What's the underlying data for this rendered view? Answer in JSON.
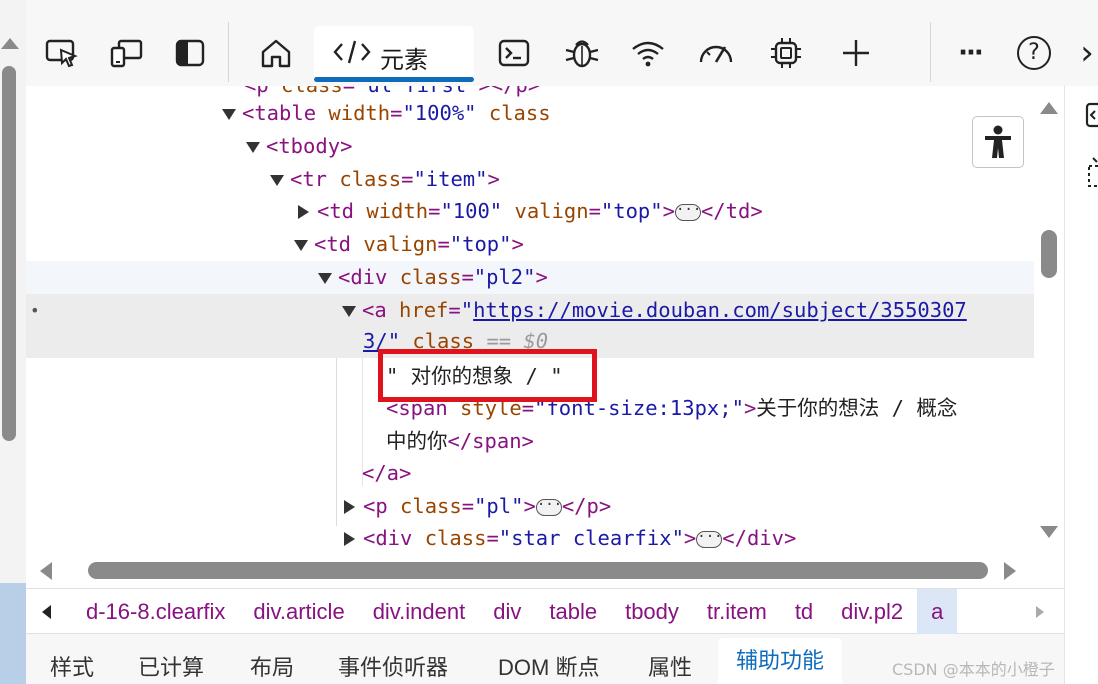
{
  "toolbar": {
    "tools": [
      {
        "name": "inspect-icon"
      },
      {
        "name": "device-emulation-icon"
      },
      {
        "name": "sidebar-toggle-icon"
      },
      {
        "name": "welcome-home-icon"
      },
      {
        "name": "console-icon"
      },
      {
        "name": "sources-bug-icon"
      },
      {
        "name": "network-wifi-icon"
      },
      {
        "name": "performance-gauge-icon"
      },
      {
        "name": "memory-chip-icon"
      },
      {
        "name": "more-tools-plus-icon"
      }
    ],
    "active_tab_label": "元素",
    "more_label": "···",
    "help_label": "?",
    "overflow_label": "›"
  },
  "dom_tree": {
    "lines": [
      {
        "pre": "<",
        "tag": "p",
        "attr": " class",
        "eq": "=",
        "val": "\"ul first\"",
        "rest": "></p>"
      },
      {
        "tag_open": "<table",
        "attr1": " width",
        "val1": "\"100%\"",
        "attr2": " class",
        "close": ">"
      },
      {
        "tag_open": "<tbody",
        "close": ">"
      },
      {
        "tag_open": "<tr",
        "attr1": " class",
        "val1": "\"item\"",
        "close": ">"
      },
      {
        "tag_open": "<td",
        "attr1": " width",
        "val1": "\"100\"",
        "attr2": " valign",
        "val2": "\"top\"",
        "close": ">",
        "end": "</td>"
      },
      {
        "tag_open": "<td",
        "attr1": " valign",
        "val1": "\"top\"",
        "close": ">"
      },
      {
        "tag_open": "<div",
        "attr1": " class",
        "val1": "\"pl2\"",
        "close": ">"
      },
      {
        "tag_open": "<a",
        "attr1": " href",
        "link1": "https://movie.douban.com/subject/3550307",
        "link2": "3/",
        "attr2": " class",
        "ghost": "== $0"
      },
      {
        "text": "\" 对你的想象 / \""
      },
      {
        "tag_open": "<span",
        "attr1": " style",
        "val1": "\"font-size:13px;\"",
        "close": ">",
        "text1": "关于你的想法 / 概念",
        "text2": "中的你",
        "end": "</span>"
      },
      {
        "end": "</a>"
      },
      {
        "tag_open": "<p",
        "attr1": " class",
        "val1": "\"pl\"",
        "close": ">",
        "end": "</p>"
      },
      {
        "tag_open": "<div",
        "attr1": " class",
        "val1": "\"star clearfix\"",
        "close": ">",
        "end": "</div>"
      }
    ],
    "ellipsis": "···",
    "eq": "="
  },
  "breadcrumbs": [
    "d-16-8.clearfix",
    "div.article",
    "div.indent",
    "div",
    "table",
    "tbody",
    "tr.item",
    "td",
    "div.pl2",
    "a"
  ],
  "bottom_tabs": [
    "样式",
    "已计算",
    "布局",
    "事件侦听器",
    "DOM 断点",
    "属性",
    "辅助功能"
  ],
  "watermark": "CSDN @本本的小橙子",
  "colors": {
    "accent": "#0f6cbd",
    "highlight_box": "#e0121c",
    "tag": "#881280",
    "attr": "#994500",
    "value": "#1a1aa6"
  }
}
